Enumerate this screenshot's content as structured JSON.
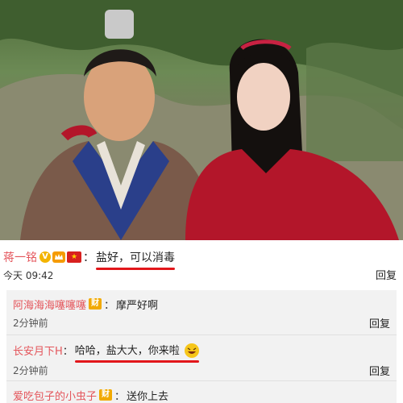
{
  "main_comment": {
    "username": "蒋一铭",
    "colon": "：",
    "text": "盐好，可以消毒",
    "time": "今天 09:42",
    "reply_label": "回复"
  },
  "replies": [
    {
      "username": "阿海海海噻噻噻",
      "badge": "财",
      "colon": "：",
      "text": "摩严好啊",
      "time": "2分钟前",
      "reply_label": "回复"
    },
    {
      "username": "长安月下H",
      "badge": "",
      "colon": "：",
      "text": "哈哈，盐大大，你来啦",
      "time": "2分钟前",
      "reply_label": "回复"
    },
    {
      "username": "爱吃包子的小虫子",
      "badge": "财",
      "colon": "：",
      "text": "送你上去"
    }
  ],
  "badges": {
    "vip_letter": "V"
  },
  "colors": {
    "username": "#e4555b",
    "underline": "#e2161b",
    "reply_bg": "#f2f2f2"
  }
}
